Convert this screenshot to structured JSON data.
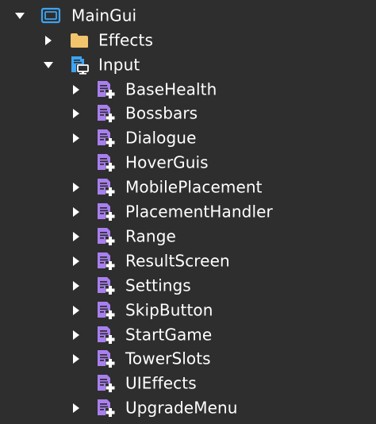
{
  "explorer": {
    "root": {
      "label": "MainGui",
      "icon": "screen-gui-icon",
      "expanded": true
    },
    "children": [
      {
        "label": "Effects",
        "icon": "folder-icon",
        "expanded": false,
        "has_children": true
      },
      {
        "label": "Input",
        "icon": "local-script-icon",
        "expanded": true,
        "has_children": true
      }
    ],
    "input_children": [
      {
        "label": "BaseHealth",
        "icon": "module-script-icon",
        "has_children": true
      },
      {
        "label": "Bossbars",
        "icon": "module-script-icon",
        "has_children": true
      },
      {
        "label": "Dialogue",
        "icon": "module-script-icon",
        "has_children": true
      },
      {
        "label": "HoverGuis",
        "icon": "module-script-icon",
        "has_children": false
      },
      {
        "label": "MobilePlacement",
        "icon": "module-script-icon",
        "has_children": true
      },
      {
        "label": "PlacementHandler",
        "icon": "module-script-icon",
        "has_children": true
      },
      {
        "label": "Range",
        "icon": "module-script-icon",
        "has_children": true
      },
      {
        "label": "ResultScreen",
        "icon": "module-script-icon",
        "has_children": true
      },
      {
        "label": "Settings",
        "icon": "module-script-icon",
        "has_children": true
      },
      {
        "label": "SkipButton",
        "icon": "module-script-icon",
        "has_children": true
      },
      {
        "label": "StartGame",
        "icon": "module-script-icon",
        "has_children": true
      },
      {
        "label": "TowerSlots",
        "icon": "module-script-icon",
        "has_children": true
      },
      {
        "label": "UIEffects",
        "icon": "module-script-icon",
        "has_children": false
      },
      {
        "label": "UpgradeMenu",
        "icon": "module-script-icon",
        "has_children": true
      }
    ],
    "colors": {
      "background": "#2e2e2e",
      "text": "#ffffff",
      "module_script": "#a97ff0",
      "folder": "#f2c46c",
      "screen_gui": "#3ea3f0",
      "arrow": "#ffffff"
    }
  }
}
